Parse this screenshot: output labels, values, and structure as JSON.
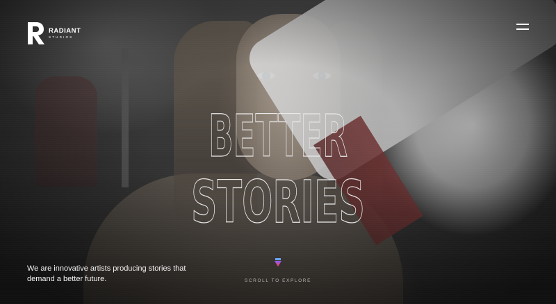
{
  "brand": {
    "name": "RADIANT",
    "subtitle": "STUDIOS"
  },
  "nav": {
    "menu_icon": "hamburger-menu-icon"
  },
  "hero": {
    "headline_line1": "BETTER",
    "headline_line2": "STORIES",
    "tagline": "We are innovative artists producing stories that demand a better future.",
    "scroll_label": "SCROLL TO EXPLORE",
    "scroll_icon": "scroll-down-triangle-icon"
  },
  "colors": {
    "text": "#ffffff",
    "headline_outline": "#e8e8e8",
    "scroll_label": "#b5b5b5",
    "scroll_icon_top": "#8a5cf6",
    "scroll_icon_bottom": "#ff3b5c"
  }
}
